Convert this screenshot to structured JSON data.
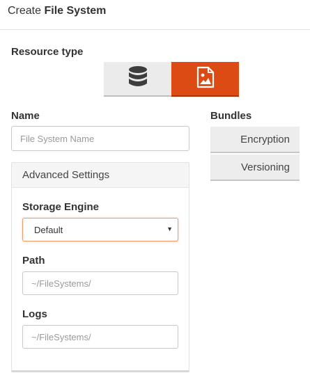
{
  "header": {
    "prefix": "Create ",
    "title": "File System"
  },
  "resource_type": {
    "label": "Resource type",
    "options": [
      {
        "icon": "database-icon",
        "selected": false
      },
      {
        "icon": "image-file-icon",
        "selected": true
      }
    ],
    "accent_color": "#dd4b14"
  },
  "name": {
    "label": "Name",
    "placeholder": "File System Name",
    "value": ""
  },
  "bundles": {
    "label": "Bundles",
    "items": [
      "Encryption",
      "Versioning"
    ]
  },
  "advanced": {
    "title": "Advanced Settings",
    "storage_engine": {
      "label": "Storage Engine",
      "value": "Default"
    },
    "path": {
      "label": "Path",
      "placeholder": "~/FileSystems/"
    },
    "logs": {
      "label": "Logs",
      "placeholder": "~/FileSystems/"
    }
  }
}
